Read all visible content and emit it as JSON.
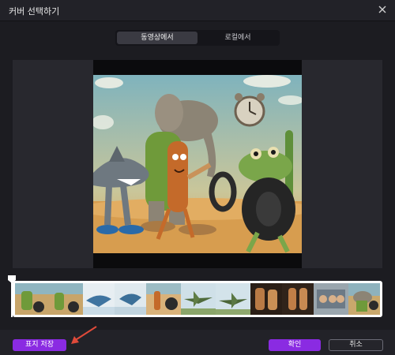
{
  "window": {
    "title": "커버 선택하기"
  },
  "tabs": [
    {
      "label": "동영상에서",
      "active": true
    },
    {
      "label": "로컬에서",
      "active": false
    }
  ],
  "preview": {
    "description_icon": "cover-image"
  },
  "timeline": {
    "frames": [
      "frame-1",
      "frame-2",
      "frame-3",
      "frame-4",
      "frame-5",
      "frame-6",
      "frame-7",
      "frame-8",
      "frame-9",
      "frame-10",
      "frame-11"
    ],
    "playhead_position": 0
  },
  "buttons": {
    "save_label": "표지 저장",
    "ok_label": "확인",
    "cancel_label": "취소"
  },
  "colors": {
    "accent": "#8a2be2",
    "background": "#1c1c21"
  }
}
